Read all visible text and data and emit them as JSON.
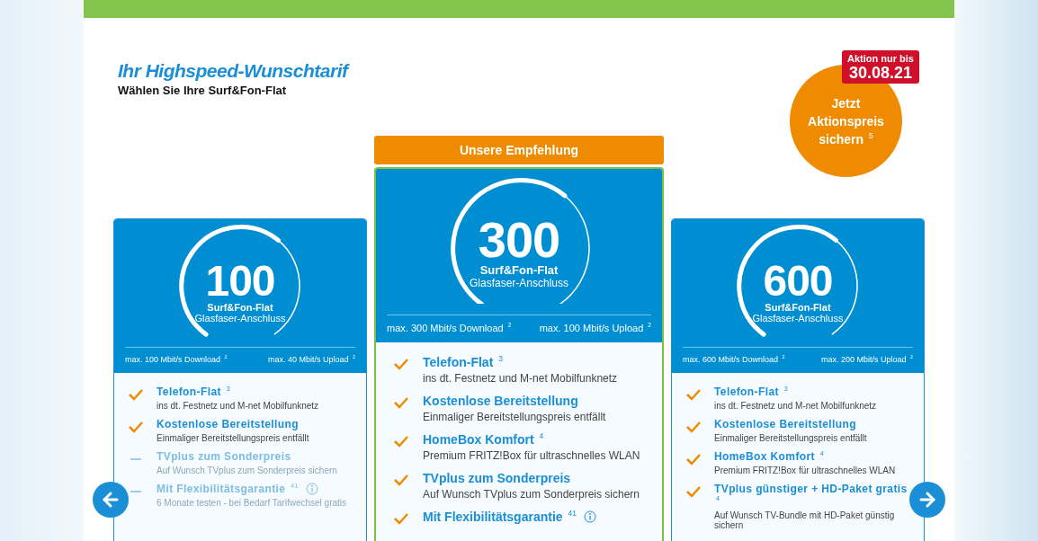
{
  "heading": {
    "title": "Ihr Highspeed-Wunschtarif",
    "subtitle": "Wählen Sie Ihre Surf&Fon-Flat"
  },
  "promo": {
    "tag_line1": "Aktion nur bis",
    "tag_line2": "30.08.21",
    "circle_text": "Jetzt Aktionspreis sichern $^{5}$"
  },
  "recommendation": "Unsere Empfehlung",
  "tariffs": [
    {
      "speed": "100",
      "name": "Surf&Fon-Flat",
      "type": "Glasfaser-Anschluss",
      "recommended": false,
      "download": "max. 100 Mbit/s Download $^{2}$",
      "upload": "max. 40 Mbit/s Upload $^{2}$",
      "features": [
        {
          "title": "Telefon-Flat $^{3}$",
          "text": "ins dt. Festnetz und M-net Mobilfunknetz",
          "included": true,
          "info": false
        },
        {
          "title": "Kostenlose Bereitstellung",
          "text": "Einmaliger Bereitstellungspreis entfällt",
          "included": true,
          "info": false
        },
        {
          "title": "TVplus zum Sonderpreis",
          "text": "Auf Wunsch TVplus zum Sonderpreis sichern",
          "included": false,
          "info": false
        },
        {
          "title": "Mit Flexibilitätsgarantie $^{41}$",
          "text": "6 Monate testen - bei Bedarf Tarifwechsel gratis",
          "included": false,
          "info": true
        }
      ]
    },
    {
      "speed": "300",
      "name": "Surf&Fon-Flat",
      "type": "Glasfaser-Anschluss",
      "recommended": true,
      "download": "max. 300 Mbit/s Download $^{2}$",
      "upload": "max. 100 Mbit/s Upload $^{2}$",
      "features": [
        {
          "title": "Telefon-Flat $^{3}$",
          "text": "ins dt. Festnetz und M-net Mobilfunknetz",
          "included": true,
          "info": false
        },
        {
          "title": "Kostenlose Bereitstellung",
          "text": "Einmaliger Bereitstellungspreis entfällt",
          "included": true,
          "info": false
        },
        {
          "title": "HomeBox Komfort $^{4}$",
          "text": "Premium FRITZ!Box für ultraschnelles WLAN",
          "included": true,
          "info": false
        },
        {
          "title": "TVplus zum Sonderpreis",
          "text": "Auf Wunsch TVplus zum Sonderpreis sichern",
          "included": true,
          "info": false
        },
        {
          "title": "Mit Flexibilitätsgarantie $^{41}$",
          "included": true,
          "info": true
        }
      ]
    },
    {
      "speed": "600",
      "name": "Surf&Fon-Flat",
      "type": "Glasfaser-Anschluss",
      "recommended": false,
      "download": "max. 600 Mbit/s Download $^{2}$",
      "upload": "max. 200 Mbit/s Upload $^{2}$",
      "features": [
        {
          "title": "Telefon-Flat $^{3}$",
          "text": "ins dt. Festnetz und M-net Mobilfunknetz",
          "included": true,
          "info": false
        },
        {
          "title": "Kostenlose Bereitstellung",
          "text": "Einmaliger Bereitstellungspreis entfällt",
          "included": true,
          "info": false
        },
        {
          "title": "HomeBox Komfort $^{4}$",
          "text": "Premium FRITZ!Box für ultraschnelles WLAN",
          "included": true,
          "info": false
        },
        {
          "title": "TVplus günstiger + HD-Paket gratis $^{4}$",
          "text": "Auf Wunsch TV-Bundle mit HD-Paket günstig sichern",
          "included": true,
          "info": false
        }
      ]
    }
  ]
}
